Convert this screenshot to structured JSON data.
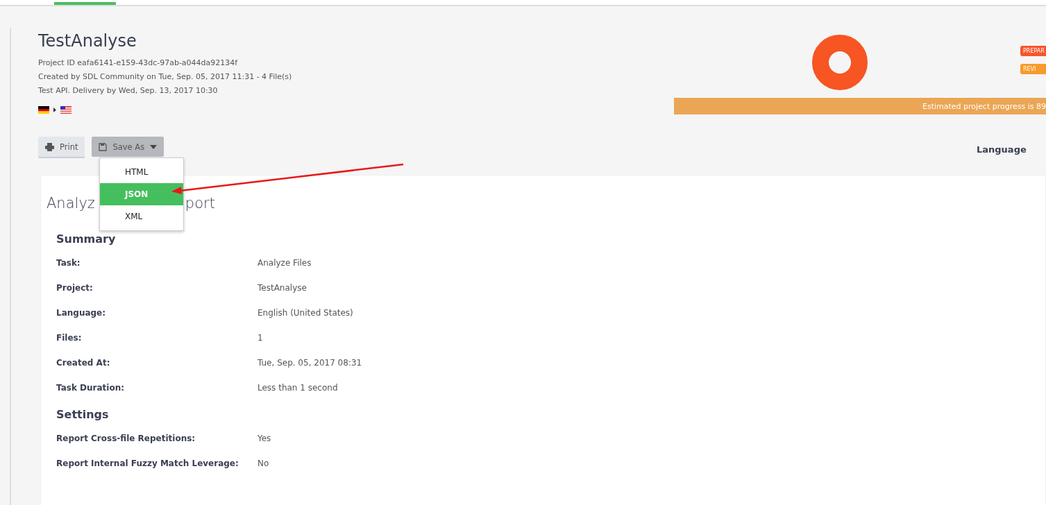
{
  "nav": {
    "active_tab_underline": true
  },
  "project": {
    "title": "TestAnalyse",
    "id_line": "Project ID eafa6141-e159-43dc-97ab-a044da92134f",
    "created_line": "Created by SDL Community on Tue, Sep. 05, 2017 11:31 - 4 File(s)",
    "delivery_line": "Test API. Delivery by Wed, Sep. 13, 2017 10:30"
  },
  "badges": [
    {
      "label": "PREPAR",
      "color": "#f7562a"
    },
    {
      "label": "REVI",
      "color": "#f89b2c"
    }
  ],
  "progress": {
    "label": "Estimated project progress is 89"
  },
  "buttons": [
    {
      "label": "Print",
      "kind": "print"
    },
    {
      "label": "Save As",
      "kind": "dropdown"
    }
  ],
  "menu": [
    {
      "label": "HTML",
      "selected": false
    },
    {
      "label": "JSON",
      "selected": true
    },
    {
      "label": "XML",
      "selected": false
    }
  ],
  "language_header": "Language",
  "report": {
    "title_start": "Analyz",
    "title_end": "port",
    "sections": [
      {
        "heading": "Summary",
        "rows": [
          {
            "key": "Task:",
            "value": "Analyze Files"
          },
          {
            "key": "Project:",
            "value": "TestAnalyse"
          },
          {
            "key": "Language:",
            "value": "English (United States)"
          },
          {
            "key": "Files:",
            "value": "1"
          },
          {
            "key": "Created At:",
            "value": "Tue, Sep. 05, 2017 08:31"
          },
          {
            "key": "Task Duration:",
            "value": "Less than 1 second"
          }
        ]
      },
      {
        "heading": "Settings",
        "rows": [
          {
            "key": "Report Cross-file Repetitions:",
            "value": "Yes"
          },
          {
            "key": "Report Internal Fuzzy Match Leverage:",
            "value": "No"
          }
        ]
      }
    ]
  }
}
